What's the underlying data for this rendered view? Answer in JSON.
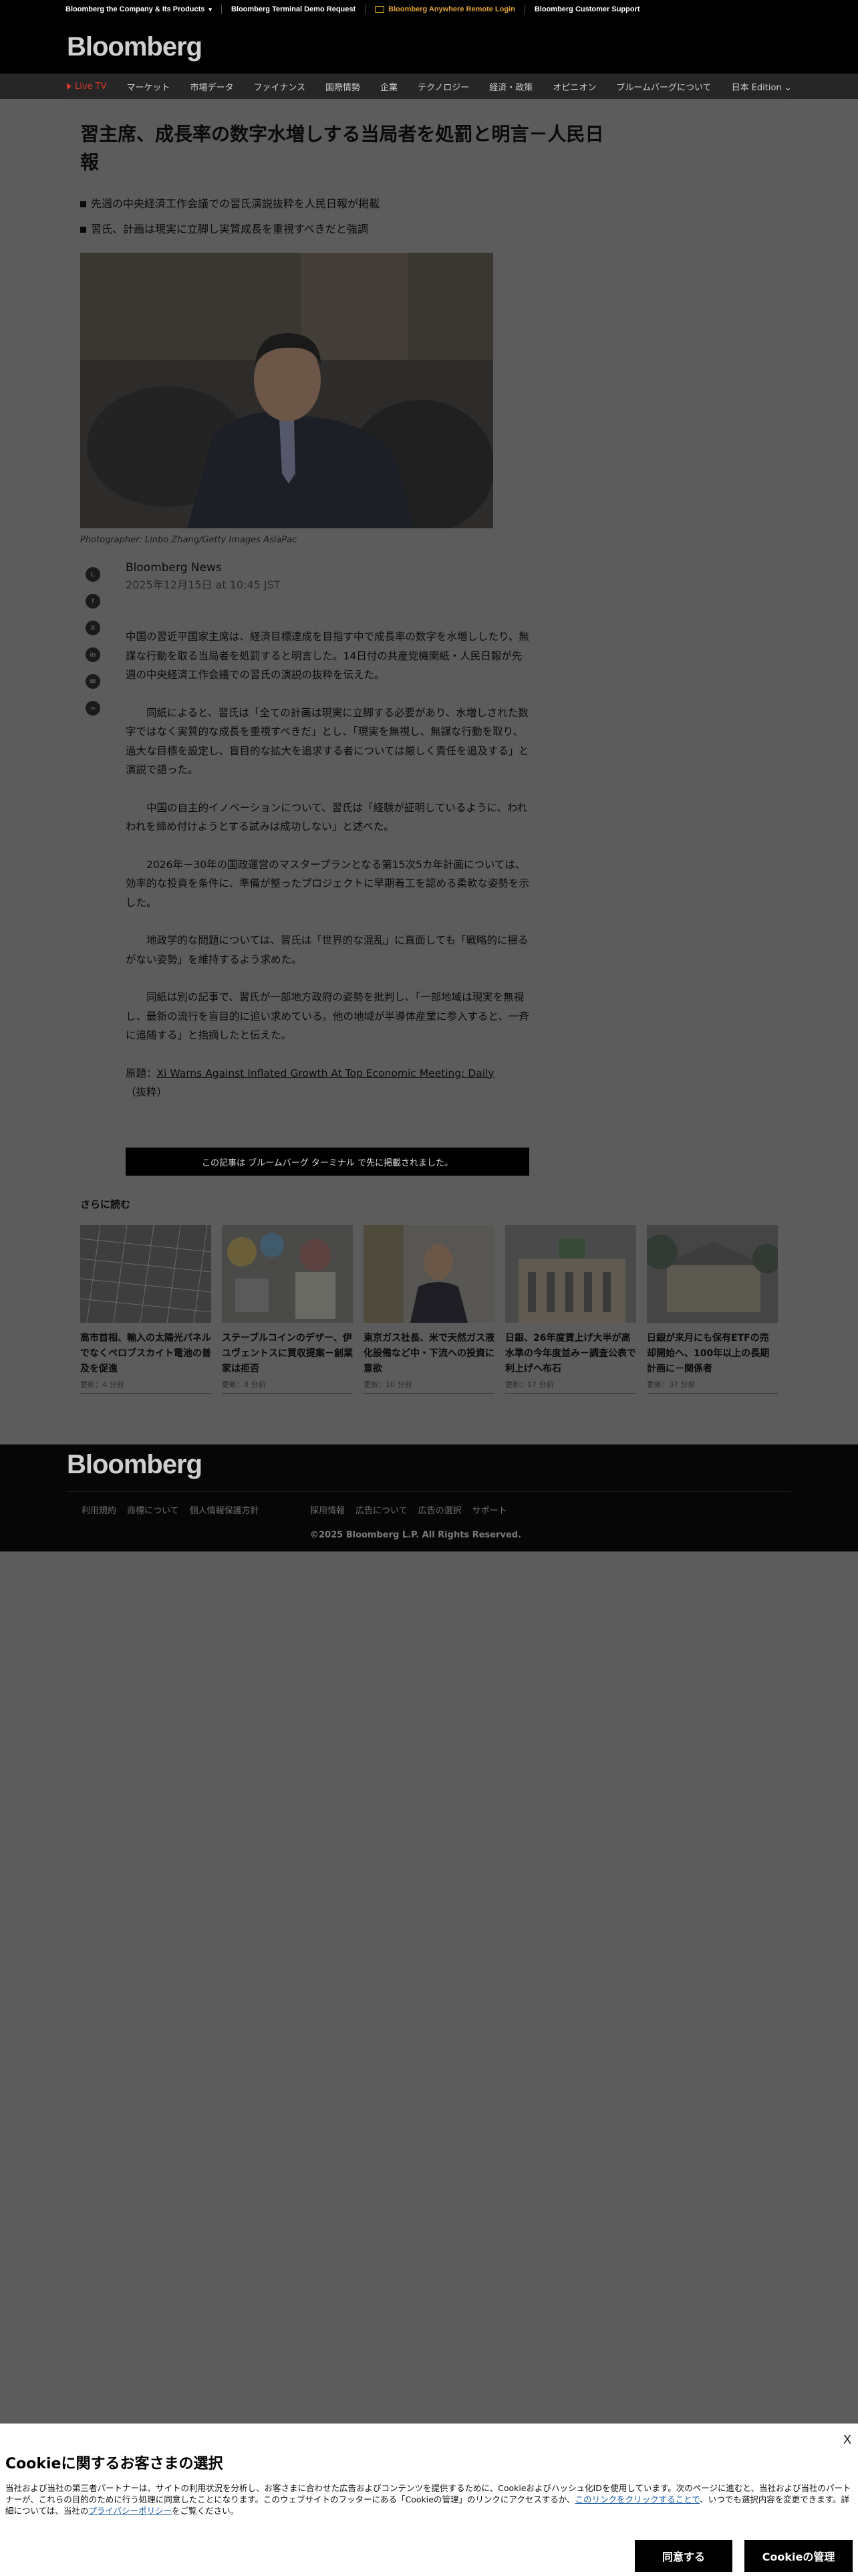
{
  "utility_bar": {
    "company": "Bloomberg the Company & Its Products",
    "demo": "Bloomberg Terminal Demo Request",
    "anywhere": "Bloomberg Anywhere Remote Login",
    "support": "Bloomberg Customer Support"
  },
  "masthead": {
    "logo": "Bloomberg"
  },
  "nav": {
    "live": "Live TV",
    "items": [
      "マーケット",
      "市場データ",
      "ファイナンス",
      "国際情勢",
      "企業",
      "テクノロジー",
      "経済・政策",
      "オピニオン",
      "ブルームバーグについて",
      "日本 Edition"
    ]
  },
  "article": {
    "title": "習主席、成長率の数字水増しする当局者を処罰と明言－人民日報",
    "abstract": [
      "先週の中央経済工作会議での習氏演説抜粋を人民日報が掲載",
      "習氏、計画は現実に立脚し実質成長を重視すべきだと強調"
    ],
    "caption": "Photographer: Linbo Zhang/Getty Images AsiaPac",
    "author": "Bloomberg News",
    "date": "2025年12月15日 at 10:45 JST",
    "paragraphs": [
      "中国の習近平国家主席は、経済目標達成を目指す中で成長率の数字を水増ししたり、無謀な行動を取る当局者を処罰すると明言した。14日付の共産党機関紙・人民日報が先週の中央経済工作会議での習氏の演説の抜粋を伝えた。",
      "同紙によると、習氏は「全ての計画は現実に立脚する必要があり、水増しされた数字ではなく実質的な成長を重視すべきだ」とし、「現実を無視し、無謀な行動を取り、過大な目標を設定し、盲目的な拡大を追求する者については厳しく責任を追及する」と演説で語った。",
      "中国の自主的イノベーションについて、習氏は「経験が証明しているように、われわれを締め付けようとする試みは成功しない」と述べた。",
      "2026年－30年の国政運営のマスタープランとなる第15次5カ年計画については、効率的な投資を条件に、準備が整ったプロジェクトに早期着工を認める柔軟な姿勢を示した。",
      "地政学的な問題については、習氏は「世界的な混乱」に直面しても「戦略的に揺るがない姿勢」を維持するよう求めた。",
      "同紙は別の記事で、習氏が一部地方政府の姿勢を批判し、「一部地域は現実を無視し、最新の流行を盲目的に追い求めている。他の地域が半導体産業に参入すると、一斉に追随する」と指摘したと伝えた。"
    ],
    "source_prefix": "原題：",
    "source_link": "Xi Warns Against Inflated Growth At Top Economic Meeting: Daily",
    "source_suffix": "（抜粋）",
    "terminal_banner": "この記事は ブルームバーグ ターミナル で先に掲載されました。"
  },
  "more_reading": {
    "heading": "さらに読む",
    "cards": [
      {
        "title": "高市首相、輸入の太陽光パネルでなくペロブスカイト電池の普及を促進",
        "time": "更新：4 分前"
      },
      {
        "title": "ステーブルコインのデザー、伊ユヴェントスに買収提案－創業家は拒否",
        "time": "更新：8 分前"
      },
      {
        "title": "東京ガス社長、米で天然ガス液化設備など中・下流への投資に意欲",
        "time": "更新：10 分前"
      },
      {
        "title": "日銀、26年度賃上げ大半が高水準の今年度並み－調査公表で利上げへ布石",
        "time": "更新：17 分前"
      },
      {
        "title": "日銀が来月にも保有ETFの売却開始へ、100年以上の長期計画に－関係者",
        "time": "更新：37 分前"
      }
    ]
  },
  "footer": {
    "logo": "Bloomberg",
    "links_left": [
      "利用規約",
      "商標について",
      "個人情報保護方針"
    ],
    "links_right": [
      "採用情報",
      "広告について",
      "広告の選択",
      "サポート"
    ],
    "copyright": "©2025 Bloomberg L.P. All Rights Reserved."
  },
  "cookie": {
    "close": "X",
    "heading": "Cookieに関するお客さまの選択",
    "body_1": "当社および当社の第三者パートナーは、サイトの利用状況を分析し、お客さまに合わせた広告およびコンテンツを提供するために、Cookieおよびハッシュ化IDを使用しています。次のページに進むと、当社および当社のパートナーが、これらの目的のために行う処理に同意したことになります。このウェブサイトのフッターにある「Cookieの管理」のリンクにアクセスするか、",
    "body_link": "このリンクをクリックすることで",
    "body_2": "、いつでも選択内容を変更できます。詳細については、当社の",
    "privacy_link": "プライバシーポリシー",
    "body_3": "をご覧ください。",
    "accept": "同意する",
    "manage": "Cookieの管理"
  }
}
